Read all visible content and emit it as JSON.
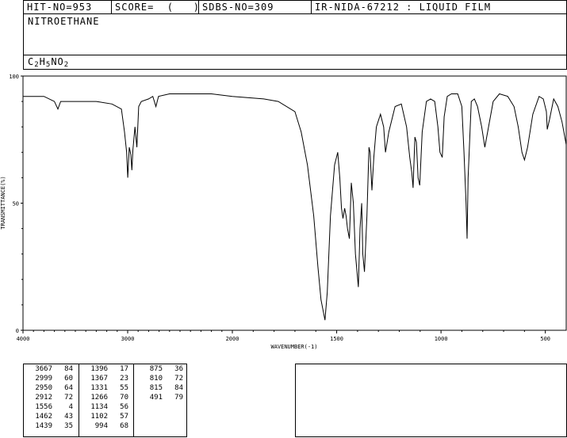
{
  "header": {
    "hit_no": "HIT-NO=953",
    "score": "SCORE=  (   )",
    "sdbs_no": "SDBS-NO=309",
    "ir_nida": "IR-NIDA-67212 : LIQUID FILM"
  },
  "compound": {
    "name": "NITROETHANE",
    "formula_parts": [
      "C",
      "2",
      "H",
      "5",
      "NO",
      "2"
    ]
  },
  "chart_data": {
    "type": "line",
    "xlabel": "WAVENUMBER(-1)",
    "ylabel": "TRANSMITTANCE(%)",
    "xlim": [
      4000,
      400
    ],
    "ylim": [
      0,
      100
    ],
    "x_ticks": [
      4000,
      3000,
      2000,
      1500,
      1000,
      500
    ],
    "y_ticks": [
      0,
      50,
      100
    ],
    "x": [
      4000,
      3800,
      3700,
      3667,
      3640,
      3560,
      3300,
      3150,
      3060,
      3030,
      3010,
      2999,
      2985,
      2970,
      2960,
      2950,
      2930,
      2912,
      2895,
      2870,
      2800,
      2760,
      2730,
      2705,
      2600,
      2400,
      2200,
      2000,
      1850,
      1780,
      1700,
      1670,
      1640,
      1610,
      1590,
      1575,
      1556,
      1545,
      1530,
      1510,
      1495,
      1485,
      1477,
      1470,
      1462,
      1455,
      1448,
      1439,
      1430,
      1420,
      1410,
      1396,
      1388,
      1380,
      1375,
      1367,
      1355,
      1345,
      1340,
      1331,
      1322,
      1310,
      1290,
      1275,
      1266,
      1250,
      1220,
      1190,
      1165,
      1150,
      1140,
      1134,
      1125,
      1118,
      1110,
      1102,
      1090,
      1070,
      1050,
      1030,
      1015,
      1005,
      994,
      985,
      970,
      950,
      920,
      900,
      890,
      880,
      875,
      870,
      855,
      840,
      825,
      815,
      805,
      790,
      750,
      720,
      680,
      650,
      630,
      612,
      600,
      585,
      560,
      530,
      510,
      495,
      491,
      480,
      460,
      440,
      420,
      400
    ],
    "y": [
      92,
      92,
      90,
      87,
      90,
      90,
      90,
      89,
      87,
      78,
      70,
      60,
      72,
      69,
      63,
      71,
      80,
      72,
      88,
      90,
      91,
      92,
      88,
      92,
      93,
      93,
      93,
      92,
      91,
      90,
      86,
      78,
      65,
      45,
      25,
      12,
      4,
      15,
      45,
      65,
      70,
      60,
      48,
      44,
      48,
      45,
      40,
      36,
      58,
      50,
      30,
      17,
      40,
      50,
      30,
      23,
      45,
      72,
      70,
      55,
      68,
      80,
      85,
      80,
      70,
      78,
      88,
      89,
      80,
      68,
      62,
      56,
      76,
      74,
      60,
      57,
      78,
      90,
      91,
      90,
      80,
      70,
      68,
      84,
      92,
      93,
      93,
      88,
      70,
      50,
      36,
      60,
      90,
      91,
      88,
      84,
      80,
      72,
      90,
      93,
      92,
      88,
      80,
      70,
      67,
      72,
      85,
      92,
      91,
      86,
      79,
      83,
      91,
      88,
      82,
      73
    ]
  },
  "peaks": {
    "columns": [
      [
        [
          "3667",
          "84"
        ],
        [
          "2999",
          "60"
        ],
        [
          "2950",
          "64"
        ],
        [
          "2912",
          "72"
        ],
        [
          "1556",
          "4"
        ],
        [
          "1462",
          "43"
        ],
        [
          "1439",
          "35"
        ]
      ],
      [
        [
          "1396",
          "17"
        ],
        [
          "1367",
          "23"
        ],
        [
          "1331",
          "55"
        ],
        [
          "1266",
          "70"
        ],
        [
          "1134",
          "56"
        ],
        [
          "1102",
          "57"
        ],
        [
          "994",
          "68"
        ]
      ],
      [
        [
          "875",
          "36"
        ],
        [
          "810",
          "72"
        ],
        [
          "815",
          "84"
        ],
        [
          "491",
          "79"
        ]
      ]
    ]
  }
}
